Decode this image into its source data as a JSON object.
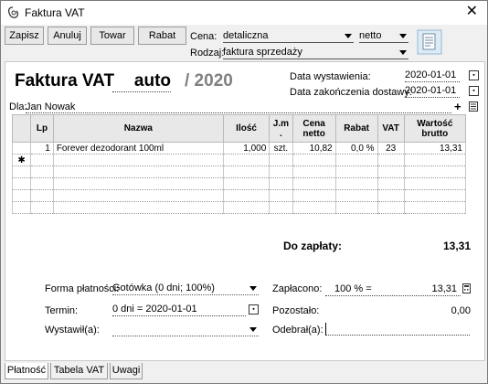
{
  "window": {
    "title": "Faktura VAT",
    "close_glyph": "✕"
  },
  "toolbar": {
    "save": "Zapisz",
    "cancel": "Anuluj",
    "product": "Towar",
    "discount": "Rabat"
  },
  "price": {
    "label": "Cena:",
    "value": "detaliczna",
    "net_gross": "netto"
  },
  "kind": {
    "label": "Rodzaj:",
    "value": "faktura sprzedaży"
  },
  "header": {
    "doc_type": "Faktura VAT",
    "number": "auto",
    "year": "/ 2020"
  },
  "dates": {
    "issue_label": "Data wystawienia:",
    "issue_value": "2020-01-01",
    "delivery_label": "Data zakończenia dostawy:",
    "delivery_value": "2020-01-01"
  },
  "customer": {
    "label": "Dla:",
    "name": "Jan Nowak",
    "add_glyph": "+"
  },
  "table": {
    "headers": {
      "lp": "Lp",
      "name": "Nazwa",
      "qty": "Ilość",
      "unit": "J.m .",
      "net_price": "Cena netto",
      "discount": "Rabat",
      "vat": "VAT",
      "gross": "Wartość brutto"
    },
    "rows": [
      {
        "lp": "1",
        "name": "Forever dezodorant 100ml",
        "qty": "1,000",
        "unit": "szt.",
        "net_price": "10,82",
        "discount": "0,0 %",
        "vat": "23",
        "gross": "13,31"
      }
    ],
    "new_row_marker": "✱"
  },
  "totals": {
    "label": "Do zapłaty:",
    "value": "13,31"
  },
  "payment": {
    "method_label": "Forma płatności:",
    "method_value": "Gotówka (0 dni; 100%)",
    "term_label": "Termin:",
    "term_value": "0 dni = 2020-01-01",
    "issuer_label": "Wystawił(a):",
    "issuer_value": "",
    "paid_label": "Zapłacono:",
    "paid_pct": "100 % =",
    "paid_amount": "13,31",
    "remaining_label": "Pozostało:",
    "remaining_value": "0,00",
    "receiver_label": "Odebrał(a):",
    "receiver_value": ""
  },
  "tabs": [
    "Płatność",
    "Tabela VAT",
    "Uwagi"
  ],
  "colors": {
    "accent": "#2b5fb3",
    "muted": "#808080",
    "background": "#f0f0f0"
  },
  "icons": {
    "app": "app-doc-icon",
    "doc": "document-icon",
    "calendar": "calendar-icon",
    "calc": "calculator-icon",
    "dropdown": "dropdown-arrow-icon",
    "customer_list": "list-icon"
  }
}
